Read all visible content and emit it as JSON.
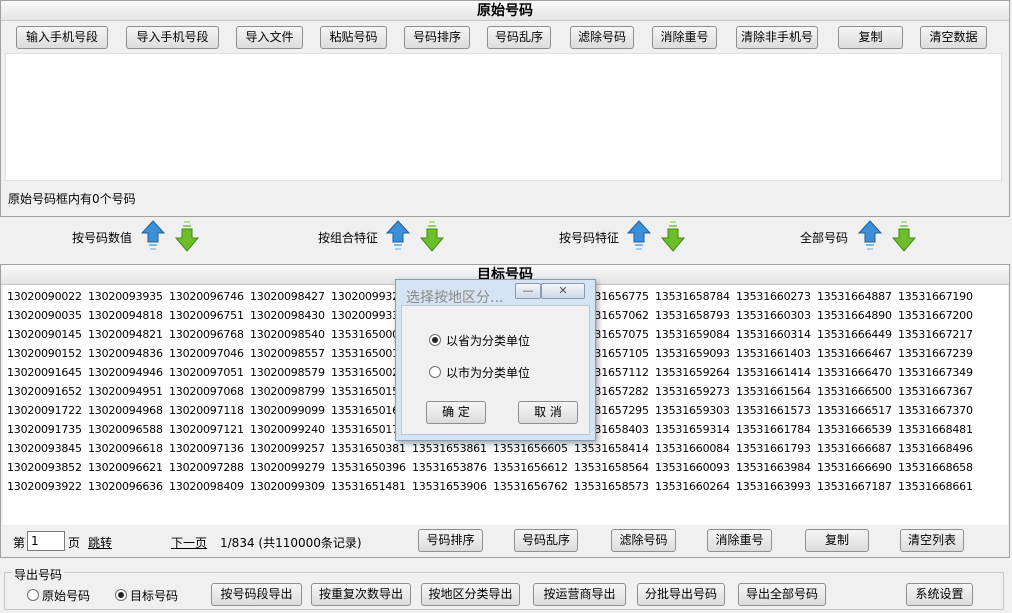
{
  "top": {
    "title": "原始号码",
    "buttons": [
      "输入手机号段",
      "导入手机号段",
      "导入文件",
      "粘贴号码",
      "号码排序",
      "号码乱序",
      "滤除号码",
      "消除重号",
      "清除非手机号",
      "复制",
      "清空数据"
    ],
    "count_text": "原始号码框内有0个号码"
  },
  "middle": {
    "labels": [
      "按号码数值",
      "按组合特征",
      "按号码特征",
      "全部号码"
    ]
  },
  "target": {
    "title": "目标号码",
    "columns": [
      [
        "13020090022",
        "13020090035",
        "13020090145",
        "13020090152",
        "13020091645",
        "13020091652",
        "13020091722",
        "13020091735",
        "13020093845",
        "13020093852",
        "13020093922"
      ],
      [
        "13020093935",
        "13020094818",
        "13020094821",
        "13020094836",
        "13020094946",
        "13020094951",
        "13020094968",
        "13020096588",
        "13020096618",
        "13020096621",
        "13020096636"
      ],
      [
        "13020096746",
        "13020096751",
        "13020096768",
        "13020097046",
        "13020097051",
        "13020097068",
        "13020097118",
        "13020097121",
        "13020097136",
        "13020097288",
        "13020098409"
      ],
      [
        "13020098427",
        "13020098430",
        "13020098540",
        "13020098557",
        "13020098579",
        "13020098799",
        "13020099099",
        "13020099240",
        "13020099257",
        "13020099279",
        "13020099309"
      ],
      [
        "13020099327",
        "13020099330",
        "13531650006",
        "13531650011",
        "13531650028",
        "13531650158",
        "13531650161",
        "13531650176",
        "13531650381",
        "13531650396",
        "13531651481"
      ],
      [
        "",
        "",
        "",
        "",
        "",
        "",
        "",
        "",
        "13531653861",
        "13531653876",
        "13531653906"
      ],
      [
        "",
        "",
        "",
        "",
        "",
        "",
        "",
        "",
        "13531656605",
        "13531656612",
        "13531656762"
      ],
      [
        "13531656775",
        "13531657062",
        "13531657075",
        "13531657105",
        "13531657112",
        "13531657282",
        "13531657295",
        "13531658403",
        "13531658414",
        "13531658564",
        "13531658573"
      ],
      [
        "13531658784",
        "13531658793",
        "13531659084",
        "13531659093",
        "13531659264",
        "13531659273",
        "13531659303",
        "13531659314",
        "13531660084",
        "13531660093",
        "13531660264"
      ],
      [
        "13531660273",
        "13531660303",
        "13531660314",
        "13531661403",
        "13531661414",
        "13531661564",
        "13531661573",
        "13531661784",
        "13531661793",
        "13531663984",
        "13531663993"
      ],
      [
        "13531664887",
        "13531664890",
        "13531666449",
        "13531666467",
        "13531666470",
        "13531666500",
        "13531666517",
        "13531666539",
        "13531666687",
        "13531666690",
        "13531667187"
      ],
      [
        "13531667190",
        "13531667200",
        "13531667217",
        "13531667239",
        "13531667349",
        "13531667367",
        "13531667370",
        "13531668481",
        "13531668496",
        "13531668658",
        "13531668661"
      ]
    ],
    "pager": {
      "page_prefix": "第",
      "page_value": "1",
      "page_suffix": "页",
      "jump": "跳转",
      "next": "下一页",
      "info": "1/834 (共110000条记录)"
    },
    "buttons": [
      "号码排序",
      "号码乱序",
      "滤除号码",
      "消除重号",
      "复制",
      "清空列表"
    ]
  },
  "export": {
    "title": "导出号码",
    "radio_original": "原始号码",
    "radio_target": "目标号码",
    "selected": "目标号码",
    "buttons": [
      "按号码段导出",
      "按重复次数导出",
      "按地区分类导出",
      "按运营商导出",
      "分批导出号码",
      "导出全部号码"
    ],
    "settings": "系统设置"
  },
  "dialog": {
    "title": "选择按地区分...",
    "option_province": "以省为分类单位",
    "option_city": "以市为分类单位",
    "selected": "以省为分类单位",
    "ok": "确 定",
    "cancel": "取 消"
  },
  "colors": {
    "arrow_up": "#3d8fd6",
    "arrow_down": "#6cbf2a"
  }
}
